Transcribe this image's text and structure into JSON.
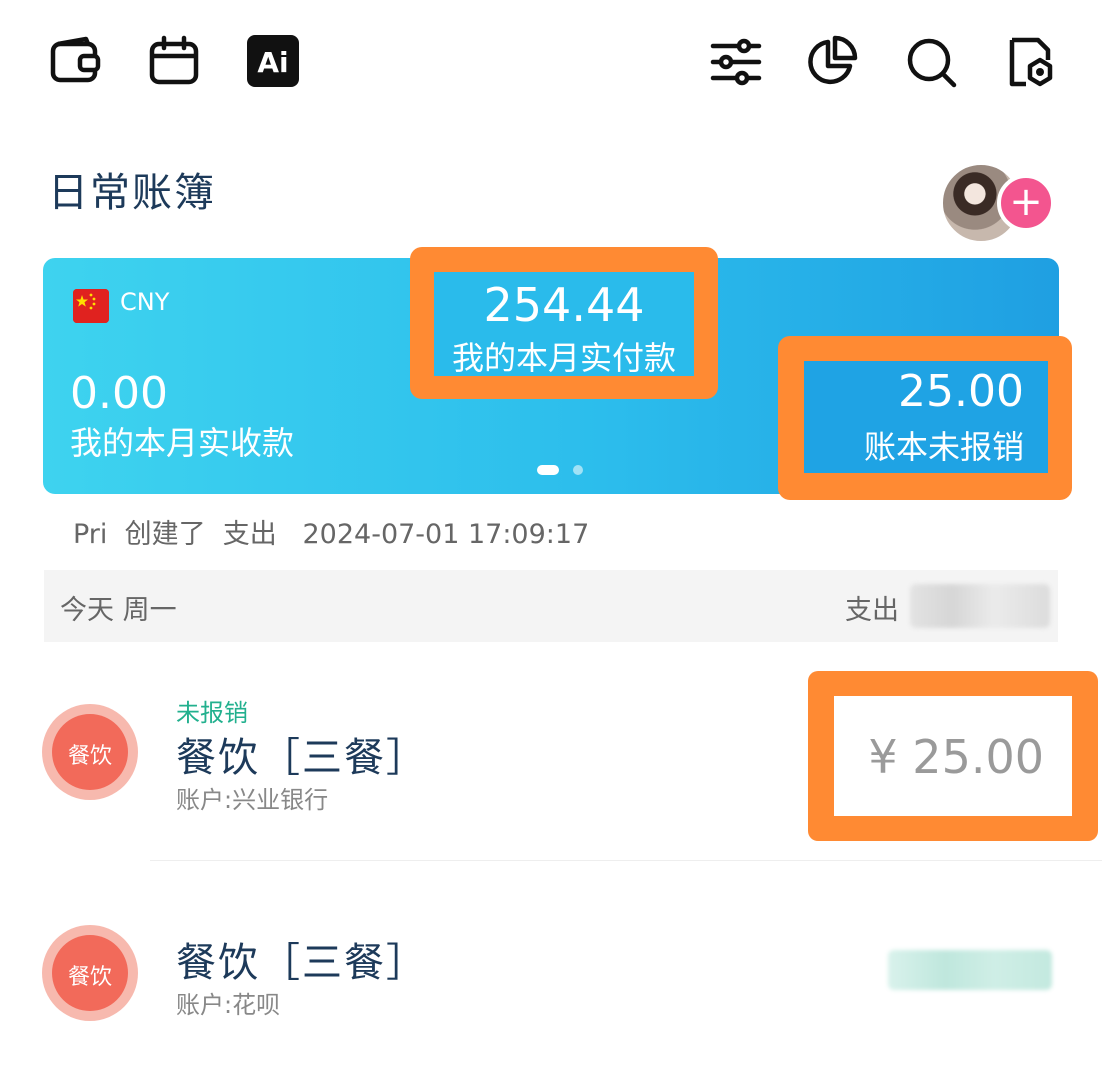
{
  "toolbar": {
    "left_icons": [
      "wallet-icon",
      "calendar-icon",
      "ai-icon"
    ],
    "ai_label": "Ai",
    "right_icons": [
      "filter-icon",
      "pie-chart-icon",
      "search-icon",
      "settings-icon"
    ]
  },
  "book": {
    "title": "日常账簿"
  },
  "colors": {
    "card_start": "#3ed3ef",
    "card_end": "#1f9fe2",
    "highlight_box": "#ff8a33",
    "avatar_add": "#f3558f",
    "badge": "#f26a5a",
    "status_green": "#22b08e"
  },
  "summary_card": {
    "currency": "CNY",
    "flag_icon": "china-flag-icon",
    "received": {
      "amount": "0.00",
      "label": "我的本月实收款"
    },
    "paid": {
      "amount": "254.44",
      "label": "我的本月实付款"
    },
    "unreimbursed": {
      "amount": "25.00",
      "label": "账本未报销"
    },
    "page_index": 1,
    "page_count": 2
  },
  "activity": {
    "text": "Pri  创建了  支出   2024-07-01 17:09:17"
  },
  "day_group": {
    "label": "今天 周一",
    "expense_label": "支出"
  },
  "transactions": [
    {
      "status": "未报销",
      "category_badge": "餐饮",
      "title": "餐饮［三餐］",
      "account": "账户:兴业银行",
      "amount": "¥ 25.00"
    },
    {
      "category_badge": "餐饮",
      "title": "餐饮［三餐］",
      "account": "账户:花呗"
    }
  ]
}
